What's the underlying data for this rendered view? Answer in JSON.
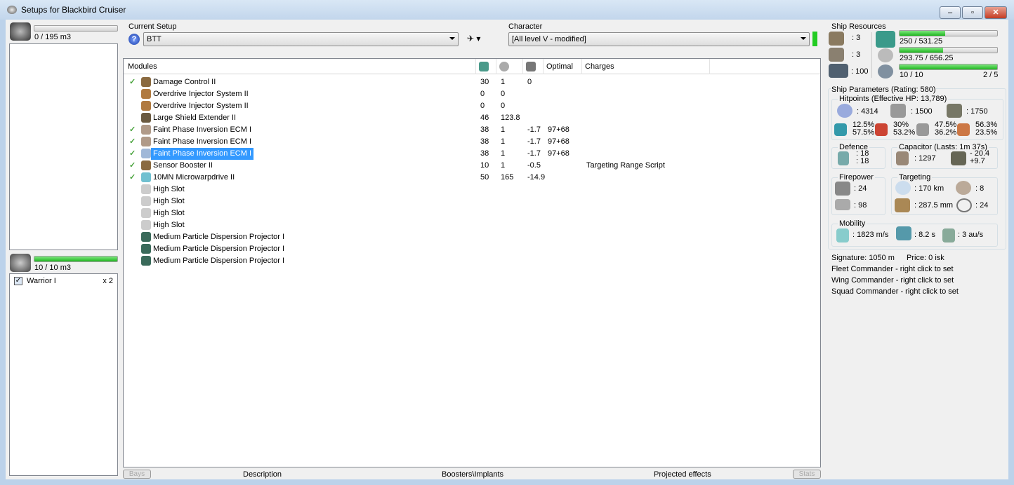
{
  "window": {
    "title": "Setups for Blackbird Cruiser",
    "controls": [
      "minimize",
      "maximize",
      "close"
    ]
  },
  "cargo": {
    "usage": "0 / 195 m3",
    "fill_fraction": 0
  },
  "drones": {
    "usage": "10 / 10 m3",
    "fill_fraction": 1,
    "items": [
      {
        "name": "Warrior I",
        "qty": "x 2",
        "checked": true
      }
    ]
  },
  "setup": {
    "label": "Current Setup",
    "value": "BTT"
  },
  "character": {
    "label": "Character",
    "value": "[All level V - modified]",
    "status_color": "#22cc22"
  },
  "modules": {
    "columns": [
      "Modules",
      "cpu-icon",
      "powergrid-icon",
      "capacitor-icon",
      "Optimal",
      "Charges"
    ],
    "rows": [
      {
        "active": true,
        "name": "Damage Control II",
        "cpu": "30",
        "pg": "1",
        "cap": "0",
        "optimal": "",
        "charges": "",
        "color": "#8a6a40"
      },
      {
        "active": false,
        "name": "Overdrive Injector System II",
        "cpu": "0",
        "pg": "0",
        "cap": "",
        "optimal": "",
        "charges": "",
        "color": "#b07a40"
      },
      {
        "active": false,
        "name": "Overdrive Injector System II",
        "cpu": "0",
        "pg": "0",
        "cap": "",
        "optimal": "",
        "charges": "",
        "color": "#b07a40"
      },
      {
        "active": false,
        "name": "Large Shield Extender II",
        "cpu": "46",
        "pg": "123.8",
        "cap": "",
        "optimal": "",
        "charges": "",
        "color": "#6b5a40"
      },
      {
        "active": true,
        "name": "Faint Phase Inversion ECM I",
        "cpu": "38",
        "pg": "1",
        "cap": "-1.7",
        "optimal": "97+68",
        "charges": "",
        "color": "#b09a88"
      },
      {
        "active": true,
        "name": "Faint Phase Inversion ECM I",
        "cpu": "38",
        "pg": "1",
        "cap": "-1.7",
        "optimal": "97+68",
        "charges": "",
        "color": "#b09a88"
      },
      {
        "active": true,
        "name": "Faint Phase Inversion ECM I",
        "cpu": "38",
        "pg": "1",
        "cap": "-1.7",
        "optimal": "97+68",
        "charges": "",
        "color": "#a0b8d8",
        "selected": true
      },
      {
        "active": true,
        "name": "Sensor Booster II",
        "cpu": "10",
        "pg": "1",
        "cap": "-0.5",
        "optimal": "",
        "charges": "Targeting Range Script",
        "color": "#8a6a40"
      },
      {
        "active": true,
        "name": "10MN Microwarpdrive II",
        "cpu": "50",
        "pg": "165",
        "cap": "-14.9",
        "optimal": "",
        "charges": "",
        "color": "#70c0d0"
      },
      {
        "active": false,
        "name": "High Slot",
        "cpu": "",
        "pg": "",
        "cap": "",
        "optimal": "",
        "charges": "",
        "color": "#cccccc"
      },
      {
        "active": false,
        "name": "High Slot",
        "cpu": "",
        "pg": "",
        "cap": "",
        "optimal": "",
        "charges": "",
        "color": "#cccccc"
      },
      {
        "active": false,
        "name": "High Slot",
        "cpu": "",
        "pg": "",
        "cap": "",
        "optimal": "",
        "charges": "",
        "color": "#cccccc"
      },
      {
        "active": false,
        "name": "High Slot",
        "cpu": "",
        "pg": "",
        "cap": "",
        "optimal": "",
        "charges": "",
        "color": "#cccccc"
      },
      {
        "active": false,
        "name": "Medium Particle Dispersion Projector I",
        "cpu": "",
        "pg": "",
        "cap": "",
        "optimal": "",
        "charges": "",
        "color": "#3a6a5a"
      },
      {
        "active": false,
        "name": "Medium Particle Dispersion Projector I",
        "cpu": "",
        "pg": "",
        "cap": "",
        "optimal": "",
        "charges": "",
        "color": "#3a6a5a"
      },
      {
        "active": false,
        "name": "Medium Particle Dispersion Projector I",
        "cpu": "",
        "pg": "",
        "cap": "",
        "optimal": "",
        "charges": "",
        "color": "#3a6a5a"
      }
    ]
  },
  "bottom_tabs": {
    "bays": "Bays",
    "description": "Description",
    "boosters": "Boosters\\Implants",
    "projected": "Projected effects",
    "stats": "Stats"
  },
  "resources": {
    "label": "Ship Resources",
    "turret": ": 3",
    "launcher": ": 3",
    "calibration": ": 100",
    "cpu": {
      "text": "250 / 531.25",
      "fraction": 0.47
    },
    "powergrid": {
      "text": "293.75 / 656.25",
      "fraction": 0.448
    },
    "drone_bandwidth": {
      "text": "10 / 10",
      "fraction": 1.0,
      "drones_active": "2 / 5"
    }
  },
  "parameters": {
    "label": "Ship Parameters (Rating: 580)",
    "hitpoints": {
      "label": "Hitpoints (Effective HP: 13,789)",
      "shield": ": 4314",
      "armor": ": 1500",
      "structure": ": 1750",
      "resists": [
        {
          "a": "12.5%",
          "b": "57.5%"
        },
        {
          "a": "30%",
          "b": "53.2%"
        },
        {
          "a": "47.5%",
          "b": "36.2%"
        },
        {
          "a": "56.3%",
          "b": "23.5%"
        }
      ]
    },
    "defence": {
      "label": "Defence",
      "a": ": 18",
      "b": ": 18"
    },
    "capacitor": {
      "label": "Capacitor (Lasts: 1m 37s)",
      "capacity": ": 1297",
      "delta_a": "- 20.4",
      "delta_b": "+9.7"
    },
    "firepower": {
      "label": "Firepower",
      "a": ": 24",
      "b": ": 98"
    },
    "targeting": {
      "label": "Targeting",
      "range": ": 170 km",
      "targets": ": 8",
      "resolution": ": 287.5 mm",
      "sensor": ": 24"
    },
    "mobility": {
      "label": "Mobility",
      "speed": ": 1823 m/s",
      "align": ": 8.2 s",
      "warp": ": 3 au/s"
    },
    "signature": "Signature: 1050 m",
    "price": "Price: 0 isk",
    "fleet": "Fleet Commander - right click to set",
    "wing": "Wing Commander - right click to set",
    "squad": "Squad Commander - right click to set"
  }
}
